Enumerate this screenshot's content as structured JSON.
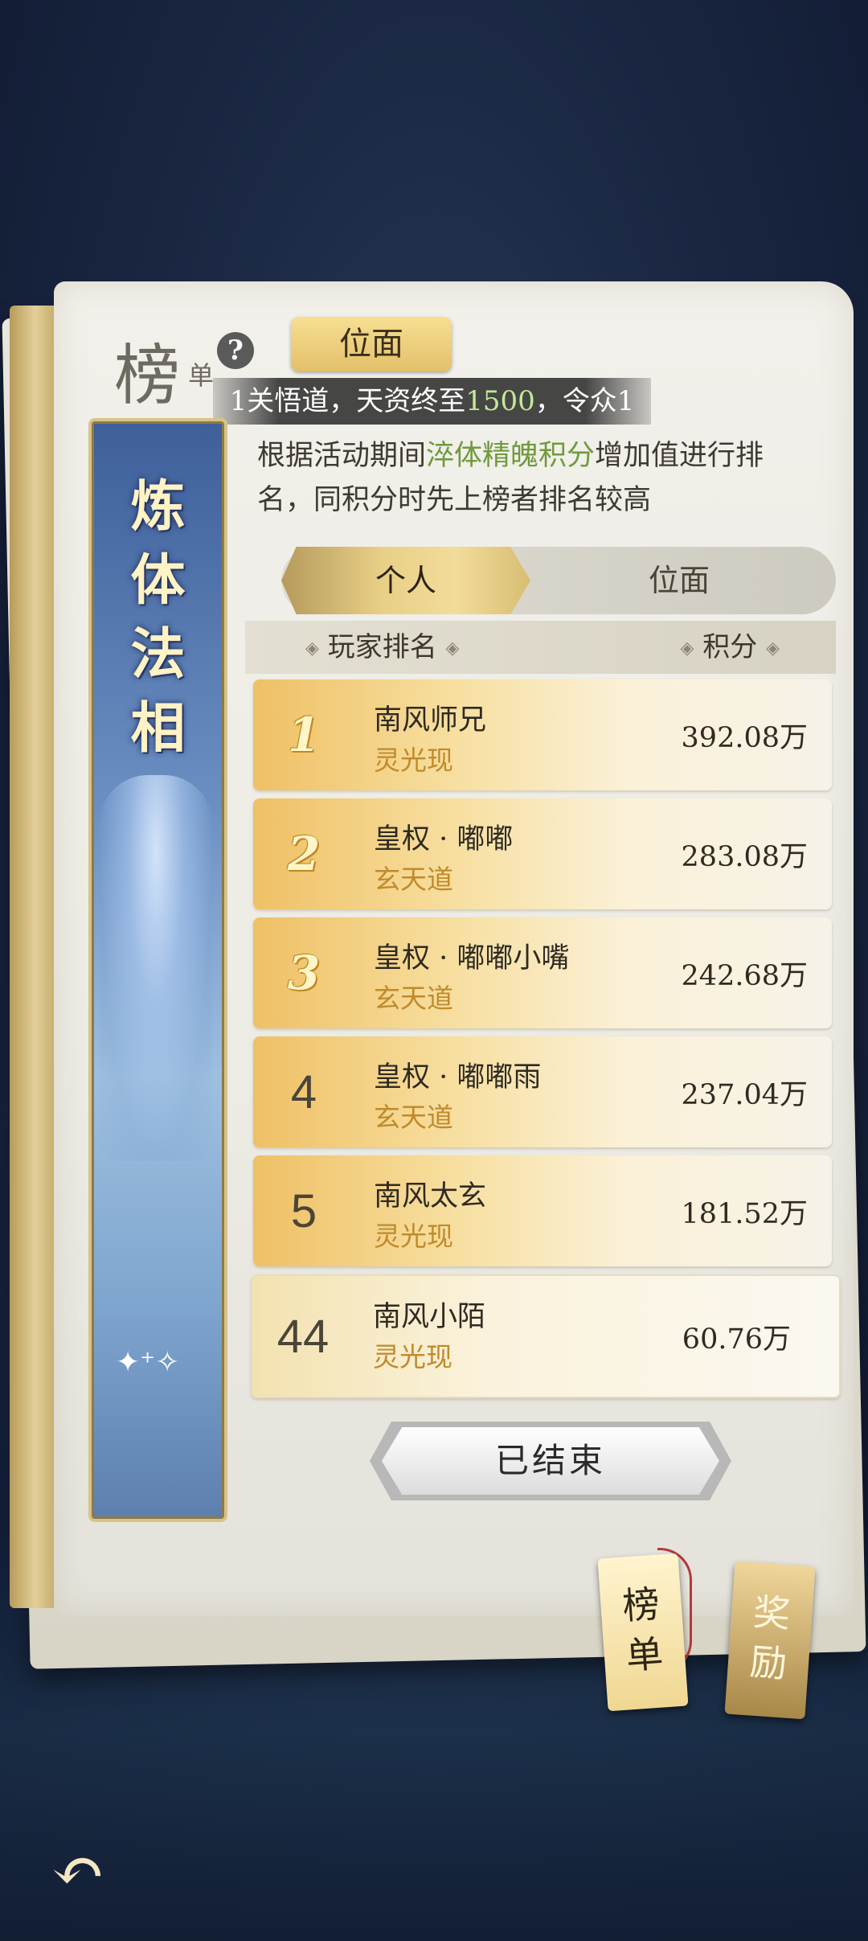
{
  "header": {
    "title": "榜",
    "title_sub": "单",
    "help_icon": "question-icon",
    "plane_tag": "位面"
  },
  "marquee": {
    "prefix": "1关悟道，天资终至",
    "highlight": "1500",
    "suffix": "，令众1"
  },
  "description": {
    "before": "根据活动期间",
    "highlight": "淬体精魄积分",
    "after": "增加值进行排名，同积分时先上榜者排名较高"
  },
  "side_banner": {
    "title_chars": [
      "炼",
      "体",
      "法",
      "相"
    ]
  },
  "tabs": {
    "personal": "个人",
    "plane": "位面",
    "active": "personal"
  },
  "table": {
    "col_player": "玩家排名",
    "col_score": "积分"
  },
  "rows": [
    {
      "rank": "1",
      "name": "南风师兄",
      "realm": "灵光现",
      "score": "392.08万"
    },
    {
      "rank": "2",
      "name": "皇权 · 嘟嘟",
      "realm": "玄天道",
      "score": "283.08万"
    },
    {
      "rank": "3",
      "name": "皇权 · 嘟嘟小嘴",
      "realm": "玄天道",
      "score": "242.68万"
    },
    {
      "rank": "4",
      "name": "皇权 · 嘟嘟雨",
      "realm": "玄天道",
      "score": "237.04万"
    },
    {
      "rank": "5",
      "name": "南风太玄",
      "realm": "灵光现",
      "score": "181.52万"
    }
  ],
  "my_row": {
    "rank": "44",
    "name": "南风小陌",
    "realm": "灵光现",
    "score": "60.76万"
  },
  "ended_button": "已结束",
  "bottom_tabs": {
    "rank": [
      "榜",
      "单"
    ],
    "reward": [
      "奖",
      "励"
    ]
  },
  "back_icon": "back-arrow-icon",
  "colors": {
    "accent_green": "#6f9a3d",
    "realm_gold": "#c08a2c",
    "marquee_green": "#c3e89a"
  }
}
